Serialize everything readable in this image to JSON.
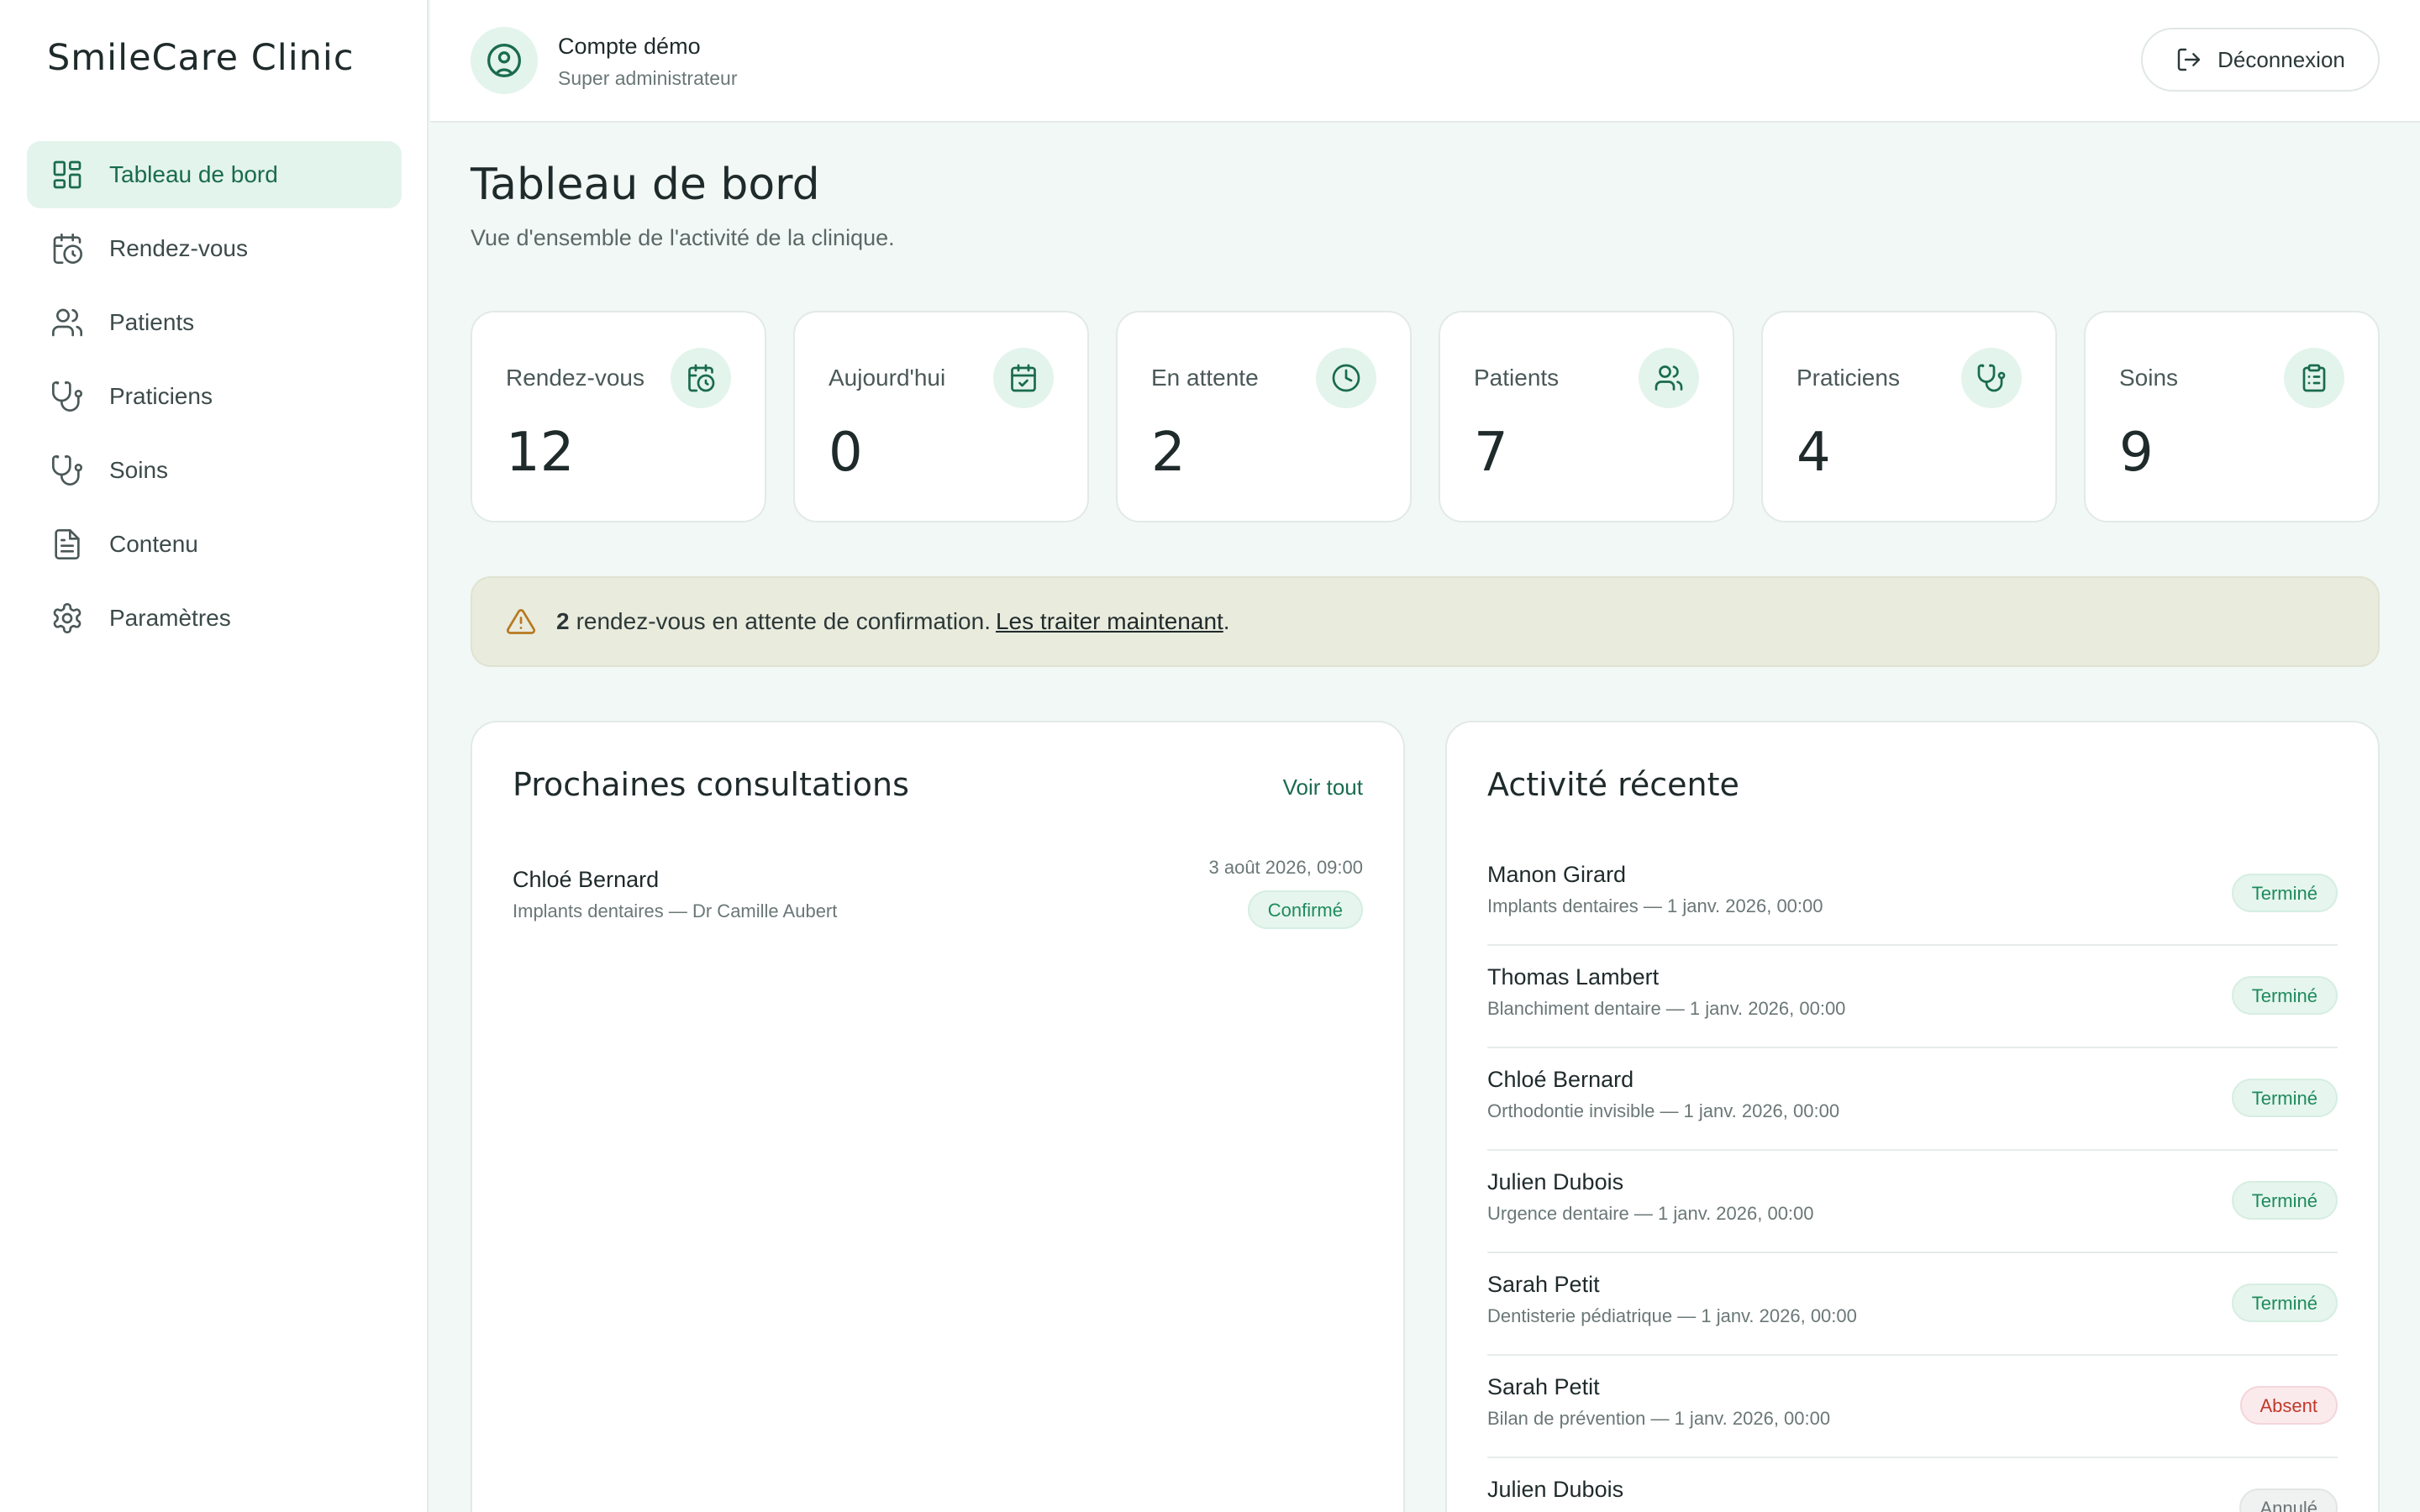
{
  "sidebar": {
    "brand": "SmileCare Clinic",
    "items": [
      {
        "label": "Tableau de bord",
        "icon": "dashboard-icon"
      },
      {
        "label": "Rendez-vous",
        "icon": "calendar-clock-icon"
      },
      {
        "label": "Patients",
        "icon": "users-icon"
      },
      {
        "label": "Praticiens",
        "icon": "stethoscope-icon"
      },
      {
        "label": "Soins",
        "icon": "stethoscope-icon"
      },
      {
        "label": "Contenu",
        "icon": "document-icon"
      },
      {
        "label": "Paramètres",
        "icon": "gear-icon"
      }
    ]
  },
  "header": {
    "account_name": "Compte démo",
    "account_role": "Super administrateur",
    "logout_label": "Déconnexion"
  },
  "page": {
    "title": "Tableau de bord",
    "subtitle": "Vue d'ensemble de l'activité de la clinique."
  },
  "stats": [
    {
      "label": "Rendez-vous",
      "value": "12",
      "icon": "calendar-clock-icon"
    },
    {
      "label": "Aujourd'hui",
      "value": "0",
      "icon": "calendar-check-icon"
    },
    {
      "label": "En attente",
      "value": "2",
      "icon": "clock-icon"
    },
    {
      "label": "Patients",
      "value": "7",
      "icon": "users-icon"
    },
    {
      "label": "Praticiens",
      "value": "4",
      "icon": "stethoscope-icon"
    },
    {
      "label": "Soins",
      "value": "9",
      "icon": "clipboard-icon"
    }
  ],
  "alert": {
    "count": "2",
    "text": "rendez-vous en attente de confirmation.",
    "link": "Les traiter maintenant",
    "suffix": "."
  },
  "upcoming": {
    "title": "Prochaines consultations",
    "see_all": "Voir tout",
    "items": [
      {
        "name": "Chloé Bernard",
        "desc": "Implants dentaires — Dr Camille Aubert",
        "date": "3 août 2026, 09:00",
        "status": "Confirmé"
      }
    ]
  },
  "activity": {
    "title": "Activité récente",
    "items": [
      {
        "name": "Manon Girard",
        "desc": "Implants dentaires — 1 janv. 2026, 00:00",
        "status": "Terminé"
      },
      {
        "name": "Thomas Lambert",
        "desc": "Blanchiment dentaire — 1 janv. 2026, 00:00",
        "status": "Terminé"
      },
      {
        "name": "Chloé Bernard",
        "desc": "Orthodontie invisible — 1 janv. 2026, 00:00",
        "status": "Terminé"
      },
      {
        "name": "Julien Dubois",
        "desc": "Urgence dentaire — 1 janv. 2026, 00:00",
        "status": "Terminé"
      },
      {
        "name": "Sarah Petit",
        "desc": "Dentisterie pédiatrique — 1 janv. 2026, 00:00",
        "status": "Terminé"
      },
      {
        "name": "Sarah Petit",
        "desc": "Bilan de prévention — 1 janv. 2026, 00:00",
        "status": "Absent"
      },
      {
        "name": "Julien Dubois",
        "desc": "",
        "status": "Annulé"
      }
    ]
  },
  "colors": {
    "accent": "#1a6b50",
    "accent_bg": "#e3f4ec",
    "page_bg": "#f2f8f5",
    "alert_bg": "#e9ebdd",
    "warning": "#b7791f",
    "absent": "#c0392b"
  }
}
